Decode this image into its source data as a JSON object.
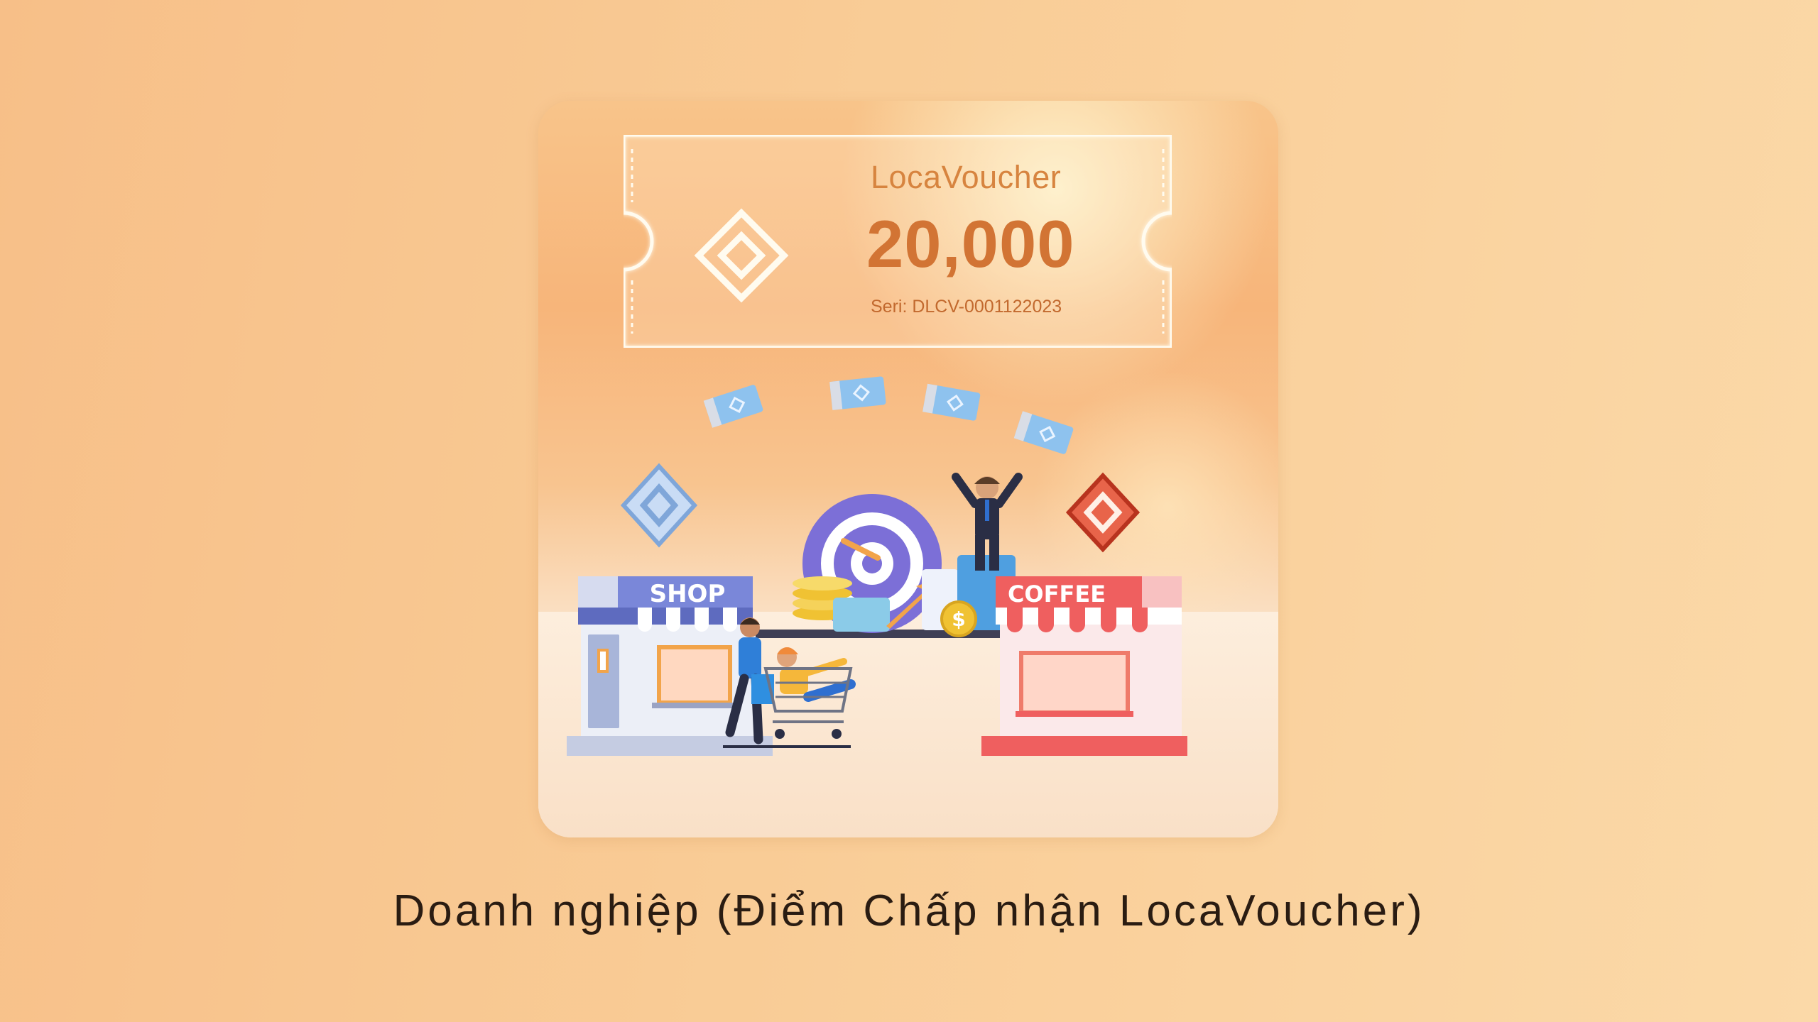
{
  "ticket": {
    "brand": "LocaVoucher",
    "amount": "20,000",
    "serial": "Seri: DLCV-0001122023"
  },
  "scene": {
    "shop_sign": "SHOP",
    "coffee_sign": "COFFEE",
    "coin_symbol": "$"
  },
  "caption": "Doanh nghiệp (Điểm Chấp nhận LocaVoucher)",
  "colors": {
    "background": "#f9cc96",
    "ticket_text": "#d27434",
    "shop_sign": "#7a87d9",
    "coffee_sign": "#ef5f5f",
    "target": "#7c6fd7"
  }
}
